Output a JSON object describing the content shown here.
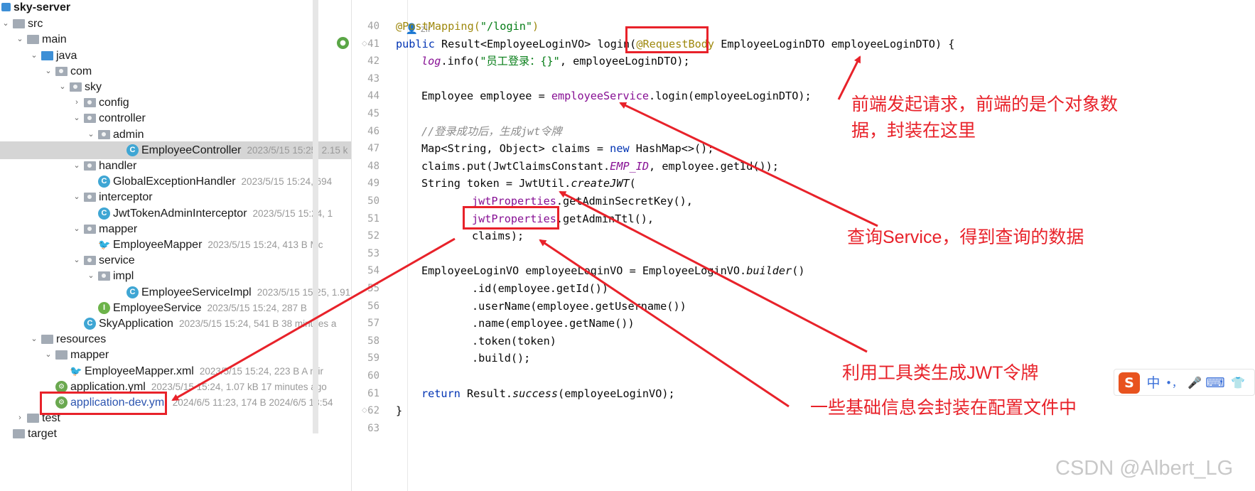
{
  "project_tree": {
    "root": "sky-server",
    "items": [
      {
        "name": "src",
        "meta": "",
        "icon": "folder-icon"
      },
      {
        "name": "main",
        "meta": "",
        "icon": "folder-icon"
      },
      {
        "name": "java",
        "meta": "",
        "icon": "source-folder-icon"
      },
      {
        "name": "com",
        "meta": "",
        "icon": "package-icon"
      },
      {
        "name": "sky",
        "meta": "",
        "icon": "package-icon"
      },
      {
        "name": "config",
        "meta": "",
        "icon": "package-icon"
      },
      {
        "name": "controller",
        "meta": "",
        "icon": "package-icon"
      },
      {
        "name": "admin",
        "meta": "",
        "icon": "package-icon"
      },
      {
        "name": "EmployeeController",
        "meta": "2023/5/15 15:25, 2.15 k",
        "icon": "class-icon"
      },
      {
        "name": "handler",
        "meta": "",
        "icon": "package-icon"
      },
      {
        "name": "GlobalExceptionHandler",
        "meta": "2023/5/15 15:24, 694",
        "icon": "class-icon"
      },
      {
        "name": "interceptor",
        "meta": "",
        "icon": "package-icon"
      },
      {
        "name": "JwtTokenAdminInterceptor",
        "meta": "2023/5/15 15:24, 1",
        "icon": "class-icon"
      },
      {
        "name": "mapper",
        "meta": "",
        "icon": "package-icon"
      },
      {
        "name": "EmployeeMapper",
        "meta": "2023/5/15 15:24, 413 B Mc",
        "icon": "mybatis-mapper-icon"
      },
      {
        "name": "service",
        "meta": "",
        "icon": "package-icon"
      },
      {
        "name": "impl",
        "meta": "",
        "icon": "package-icon"
      },
      {
        "name": "EmployeeServiceImpl",
        "meta": "2023/5/15 15:25, 1.91",
        "icon": "class-icon"
      },
      {
        "name": "EmployeeService",
        "meta": "2023/5/15 15:24, 287 B",
        "icon": "interface-icon"
      },
      {
        "name": "SkyApplication",
        "meta": "2023/5/15 15:24, 541 B 38 minutes a",
        "icon": "spring-boot-class-icon"
      },
      {
        "name": "resources",
        "meta": "",
        "icon": "resources-folder-icon"
      },
      {
        "name": "mapper",
        "meta": "",
        "icon": "folder-icon"
      },
      {
        "name": "EmployeeMapper.xml",
        "meta": "2023/5/15 15:24, 223 B A mir",
        "icon": "mybatis-xml-icon"
      },
      {
        "name": "application.yml",
        "meta": "2023/5/15 15:24, 1.07 kB 17 minutes ago",
        "icon": "yml-icon"
      },
      {
        "name": "application-dev.yml",
        "meta": "2024/6/5 11:23, 174 B 2024/6/5 13:54",
        "icon": "yml-icon"
      },
      {
        "name": "test",
        "meta": "",
        "icon": "folder-icon"
      },
      {
        "name": "target",
        "meta": "",
        "icon": "folder-icon"
      }
    ]
  },
  "editor": {
    "author": "zlr",
    "line_numbers": [
      "40",
      "41",
      "42",
      "43",
      "44",
      "45",
      "46",
      "47",
      "48",
      "49",
      "50",
      "51",
      "52",
      "53",
      "54",
      "55",
      "56",
      "57",
      "58",
      "59",
      "60",
      "61",
      "62",
      "63"
    ],
    "lines": {
      "l40": {
        "a": "@PostMapping(",
        "b": "\"/login\"",
        "c": ")"
      },
      "l41": {
        "a": "public ",
        "b": "Result<EmployeeLoginVO> login(",
        "c": "@RequestBody",
        "d": " EmployeeLoginDTO employeeLoginDTO) {"
      },
      "l42": {
        "a": "log",
        "b": ".info(",
        "c": "\"员工登录：{}\"",
        "d": ", employeeLoginDTO);"
      },
      "l44": {
        "a": "Employee employee = ",
        "b": "employeeService",
        "c": ".login(employeeLoginDTO);"
      },
      "l46": {
        "a": "//登录成功后，生成jwt令牌"
      },
      "l47": {
        "a": "Map<String, Object> claims = ",
        "b": "new ",
        "c": "HashMap<>();"
      },
      "l48": {
        "a": "claims.put(JwtClaimsConstant.",
        "b": "EMP_ID",
        "c": ", employee.getId());"
      },
      "l49": {
        "a": "String token = JwtUtil.",
        "b": "createJWT",
        "c": "("
      },
      "l50": {
        "a": "jwtProperties",
        "b": ".getAdminSecretKey(),"
      },
      "l51": {
        "a": "jwtProperties",
        "b": ".getAdminTtl(),"
      },
      "l52": {
        "a": "claims);"
      },
      "l54": {
        "a": "EmployeeLoginVO employeeLoginVO = EmployeeLoginVO.",
        "b": "builder",
        "c": "()"
      },
      "l55": {
        "a": ".id(employee.getId())"
      },
      "l56": {
        "a": ".userName(employee.getUsername())"
      },
      "l57": {
        "a": ".name(employee.getName())"
      },
      "l58": {
        "a": ".token(token)"
      },
      "l59": {
        "a": ".build();"
      },
      "l61": {
        "a": "return ",
        "b": "Result.",
        "c": "success",
        "d": "(employeeLoginVO);"
      },
      "l62": {
        "a": "}"
      }
    }
  },
  "annotations": {
    "note1_line1": "前端发起请求，前端的是个对象数",
    "note1_line2": "据，封装在这里",
    "note2": "查询Service，得到查询的数据",
    "note3": "利用工具类生成JWT令牌",
    "note4": "一些基础信息会封装在配置文件中"
  },
  "ime_toolbar": {
    "logo": "S",
    "lang": "中",
    "punct": "•，",
    "mic": "🎤",
    "keyboard": "⌨",
    "skin": "👕"
  },
  "watermark": "CSDN @Albert_LG",
  "colors": {
    "annotation_red": "#e8222a",
    "keyword": "#0033b3",
    "annotation_yellow": "#9e880d",
    "string": "#067d17",
    "field": "#871094"
  }
}
